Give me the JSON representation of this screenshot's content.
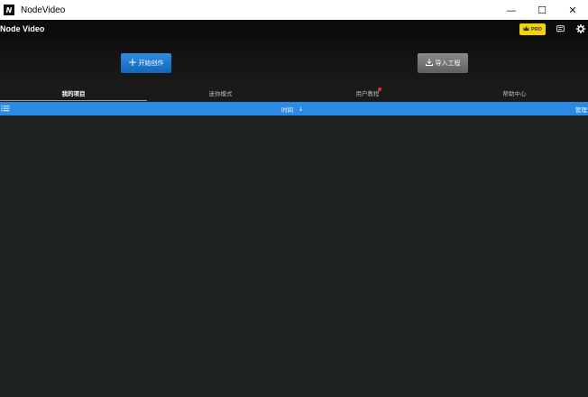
{
  "window": {
    "title": "NodeVideo",
    "logo_letter": "N",
    "minimize_glyph": "—",
    "maximize_glyph": "☐",
    "close_glyph": "✕"
  },
  "header": {
    "brand": "Node Video",
    "pro_label": "PRO",
    "icons": [
      "crown-icon",
      "comment-icon",
      "gear-icon"
    ]
  },
  "actions": {
    "create_label": "开始创作",
    "import_label": "导入工程"
  },
  "tabs": [
    {
      "label": "我的项目",
      "active": true
    },
    {
      "label": "迷你模式",
      "active": false
    },
    {
      "label": "用户教程",
      "active": false,
      "badge": true
    },
    {
      "label": "帮助中心",
      "active": false
    }
  ],
  "sortbar": {
    "sort_label": "时间",
    "sort_arrow": "↓",
    "manage_label": "管理"
  },
  "colors": {
    "accent_blue": "#2a8ae6",
    "pro_yellow": "#f2d20c",
    "badge_red": "#e52b2b",
    "background": "#1d2323"
  }
}
